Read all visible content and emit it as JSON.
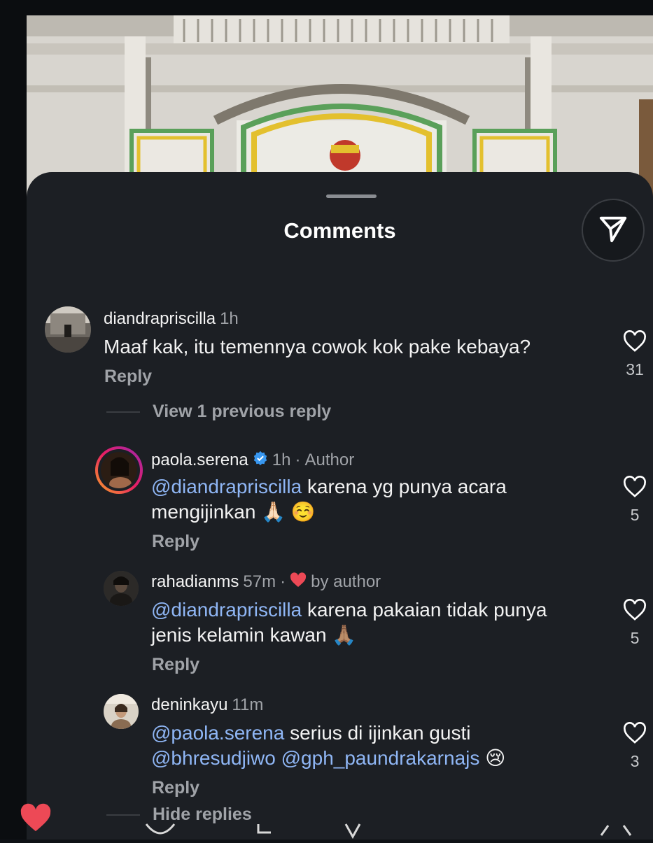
{
  "sheet": {
    "title": "Comments"
  },
  "comments": [
    {
      "username": "diandrapriscilla",
      "time": "1h",
      "text": "Maaf kak, itu temennya cowok kok pake kebaya?",
      "reply_label": "Reply",
      "likes": "31"
    }
  ],
  "thread": {
    "view_previous_label": "View 1 previous reply",
    "hide_label": "Hide replies"
  },
  "replies": [
    {
      "username": "paola.serena",
      "verified": true,
      "time": "1h",
      "separator": "·",
      "tag": "Author",
      "mention": "@diandrapriscilla",
      "text_1": "karena yg punya acara",
      "text_2": "mengijinkan",
      "emoji": "🙏🏻 ☺️",
      "reply_label": "Reply",
      "likes": "5"
    },
    {
      "username": "rahadianms",
      "time": "57m",
      "separator": "·",
      "tag": "by author",
      "mention": "@diandrapriscilla",
      "text_1": "karena pakaian tidak punya",
      "text_2": "jenis kelamin kawan",
      "emoji": "🙏🏽",
      "reply_label": "Reply",
      "likes": "5"
    },
    {
      "username": "deninkayu",
      "time": "11m",
      "mention": "@paola.serena",
      "text_1": "serius di ijinkan gusti",
      "mention_2": "@bhresudjiwo",
      "mention_3": "@gph_paundrakarnajs",
      "emoji": "😢",
      "reply_label": "Reply",
      "likes": "3"
    }
  ],
  "colors": {
    "sheet_bg": "#1c1f24",
    "mention": "#8fb6f5",
    "verified": "#3897f0",
    "liked_heart": "#ed4956",
    "secondary_text": "#a0a3a8"
  },
  "icons": {
    "share": "send-icon",
    "like": "heart-outline-icon",
    "verified": "verified-badge-icon",
    "liked_by_author": "heart-filled-icon"
  }
}
